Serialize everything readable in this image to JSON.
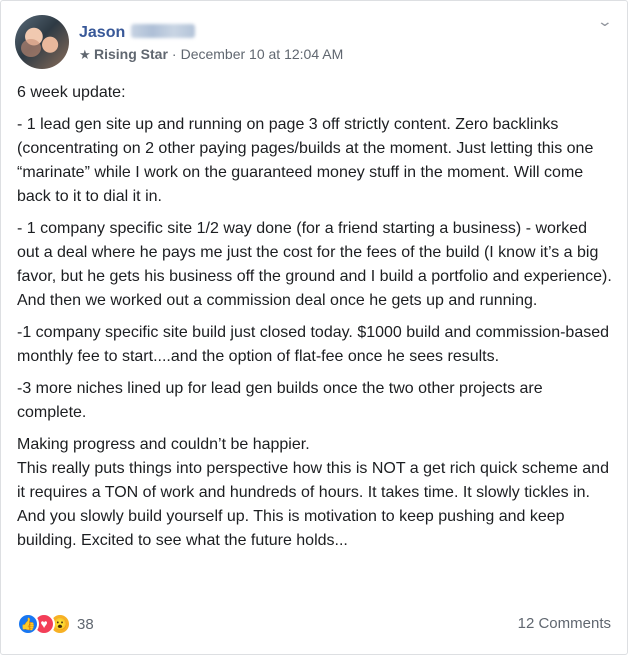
{
  "post": {
    "author": {
      "name": "Jason",
      "badge_icon": "star-icon",
      "badge": "Rising Star"
    },
    "timestamp": "December 10 at 12:04 AM",
    "menu_icon": "chevron-down-icon",
    "paragraphs": [
      "6 week update:",
      "- 1 lead gen site up and running on page 3 off strictly content. Zero backlinks (concentrating on 2 other paying pages/builds at the moment. Just letting this one “marinate” while I work on the guaranteed money stuff in the moment. Will come back to it to dial it in.",
      "- 1 company specific site 1/2 way done (for a friend starting a business) - worked out a deal where he pays me just the cost for the fees of the build (I know it’s a big favor, but he gets his business off the ground and I build a portfolio and experience). And then we worked out a commission deal once he gets up and running.",
      "-1 company specific site build just closed today. $1000 build and commission-based monthly fee to start....and the option of flat-fee once he sees results.",
      "-3 more niches lined up for lead gen builds once the two other projects are complete."
    ],
    "closing_line_1": "Making progress and couldn’t be happier.",
    "closing_line_2": "This really puts things into perspective how this is NOT a get rich quick scheme and it requires a TON of work and hundreds of hours. It takes time. It slowly tickles in. And you slowly build yourself up. This is motivation to keep pushing and keep building. Excited to see what the future holds...",
    "reactions": {
      "types": [
        "like-icon",
        "love-icon",
        "wow-icon"
      ],
      "count": "38"
    },
    "comments_label": "12 Comments"
  }
}
